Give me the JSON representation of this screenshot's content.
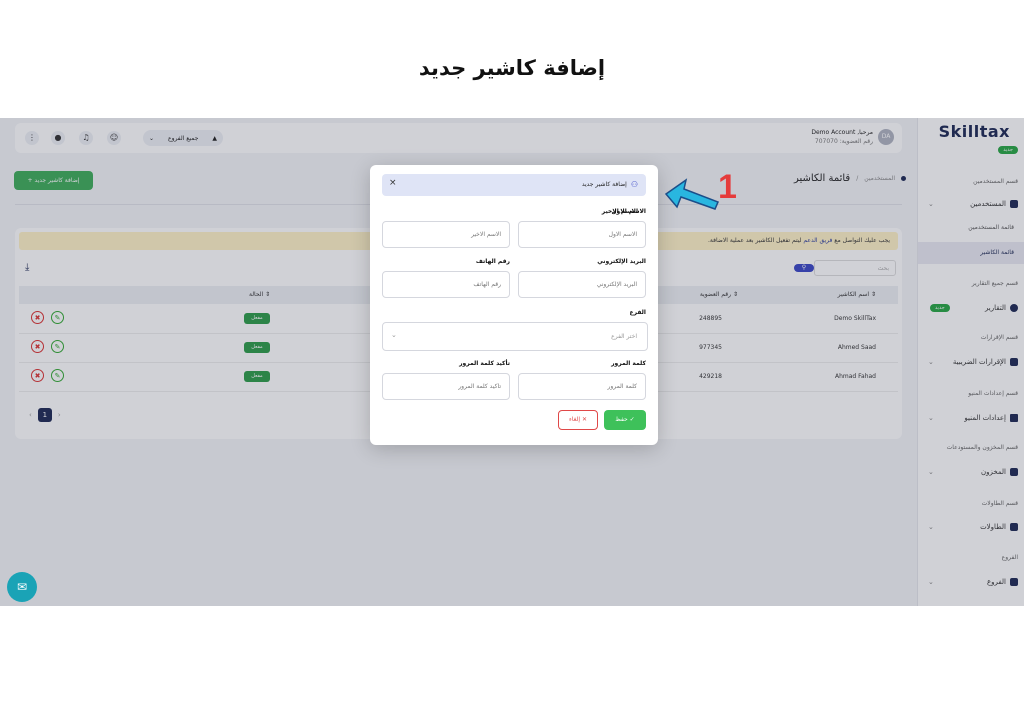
{
  "page_title": "إضافة كاشير جديد",
  "app": {
    "logo": "Skilltax",
    "topbar": {
      "branch_select": "جميع الفروع",
      "user_greeting": "مرحبا, Demo Account",
      "user_member_no": "رقم العضوية: 707070",
      "avatar_initials": "DA"
    },
    "sidebar": {
      "top_badge": "جديد",
      "users_section": "قسم المستخدمين",
      "users": "المستخدمين",
      "users_list": "قائمة المستخدمين",
      "cashier_list": "قائمة الكاشير",
      "reports_section": "قسم جميع التقارير",
      "reports": "التقارير",
      "reports_badge": "جديد",
      "tax_section": "قسم الإقرارات",
      "tax": "الإقرارات الضريبية",
      "menu_section": "قسم إعدادات المنيو",
      "menu": "إعدادات المنيو",
      "stock_section": "قسم المخزون والمستودعات",
      "stock": "المخزون",
      "tables_section": "قسم الطاولات",
      "tables": "الطاولات",
      "branches_section": "الفروع",
      "branches": "الفروع"
    },
    "header": {
      "breadcrumb_parent": "المستخدمين",
      "breadcrumb_current": "قائمة الكاشير",
      "add_button": "إضافة كاشير جديد +"
    },
    "notice": {
      "before": "يجب عليك التواصل مع",
      "link": "فريق الدعم",
      "after": "ليتم تفعيل الكاشير بعد عملية الاضافة."
    },
    "table": {
      "search_placeholder": "بحث",
      "columns": [
        "اسم الكاشير",
        "رقم العضوية",
        "الحالة"
      ],
      "rows": [
        {
          "name": "Demo SkillTax",
          "member": "248895",
          "status": "مفعل"
        },
        {
          "name": "Ahmed Saad",
          "member": "977345",
          "status": "مفعل"
        },
        {
          "name": "Ahmad Fahad",
          "member": "429218",
          "status": "مفعل"
        }
      ],
      "page": "1"
    }
  },
  "modal": {
    "title": "إضافة كاشير جديد",
    "first_name_label": "الاسم الاول",
    "first_name_placeholder": "الاسم الاول",
    "last_name_label": "الاسم الاخير",
    "last_name_placeholder": "الاسم الاخير",
    "email_label": "البريد الإلكتروني",
    "email_placeholder": "البريد الإلكتروني",
    "phone_label": "رقم الهاتف",
    "phone_placeholder": "رقم الهاتف",
    "branch_label": "الفرع",
    "branch_placeholder": "اختر الفرع",
    "password_label": "كلمة المرور",
    "password_placeholder": "كلمة المرور",
    "confirm_label": "تأكيد كلمة المرور",
    "confirm_placeholder": "تأكيد كلمة المرور",
    "save": "حفظ",
    "cancel": "إلغاء"
  },
  "annotation_number": "1",
  "colors": {
    "primary": "#1e2a55",
    "save": "#3ec15a",
    "cancel": "#e04848",
    "annotation": "#e53b3b",
    "arrow": "#29b6e0"
  }
}
